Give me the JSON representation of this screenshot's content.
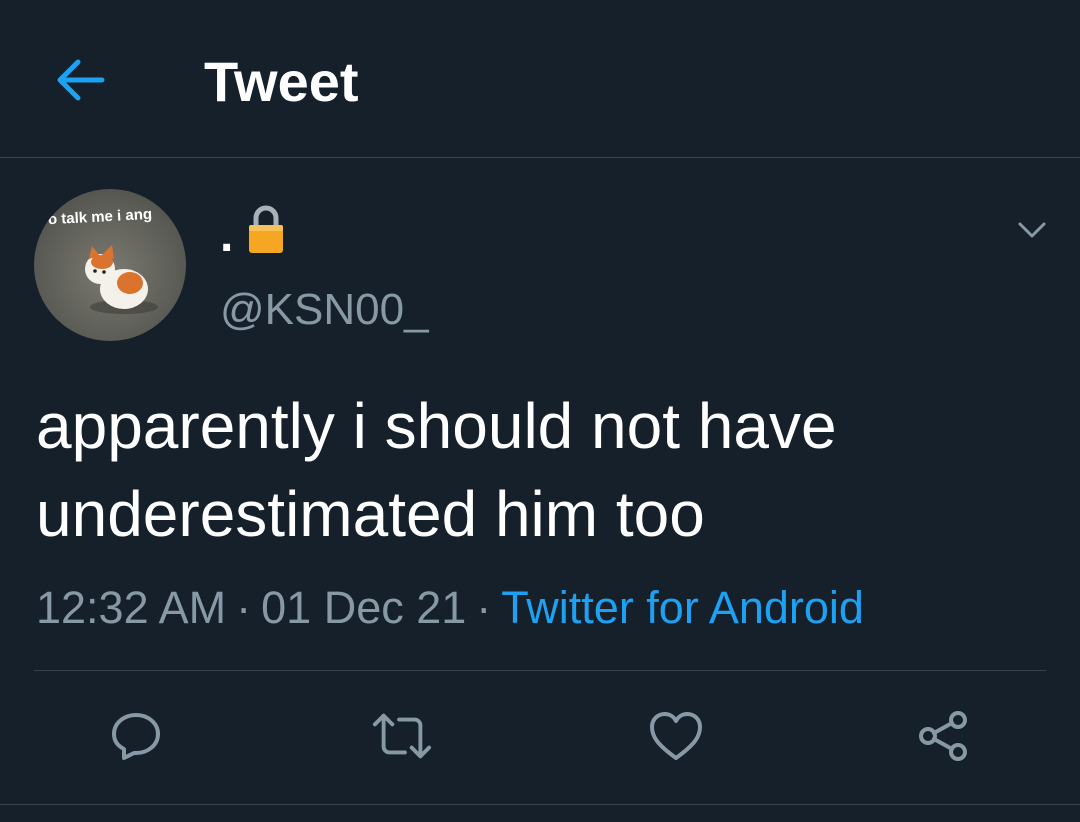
{
  "header": {
    "back_icon": "arrow-left-icon",
    "title": "Tweet",
    "accent": "#1da1f2"
  },
  "author": {
    "avatar_text": "o talk me i ang",
    "display_name": ".",
    "lock_icon": "lock-icon",
    "handle": "@KSN00_"
  },
  "tweet": {
    "text": "apparently i should not have underestimated him too",
    "time": "12:32 AM",
    "date": "01 Dec 21",
    "source": "Twitter for Android",
    "separator": "·"
  },
  "actions": [
    {
      "icon": "reply-icon"
    },
    {
      "icon": "retweet-icon"
    },
    {
      "icon": "like-icon"
    },
    {
      "icon": "share-icon"
    }
  ],
  "colors": {
    "background": "#15202b",
    "text_primary": "#ffffff",
    "text_secondary": "#8899a6",
    "link": "#1da1f2",
    "divider": "#38444d"
  }
}
